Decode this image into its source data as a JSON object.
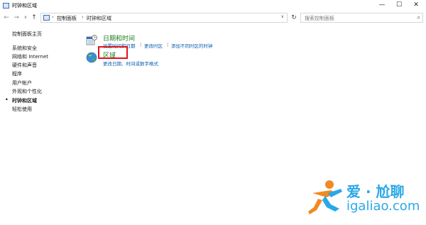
{
  "window": {
    "title": "时钟和区域",
    "minimize_glyph": "—",
    "maximize_glyph": "☐",
    "close_glyph": "✕"
  },
  "nav": {
    "back_glyph": "←",
    "forward_glyph": "→",
    "dropdown_glyph": "∨",
    "up_glyph": "↑",
    "refresh_glyph": "↻"
  },
  "address": {
    "separator": "›",
    "crumbs": [
      "控制面板",
      "时钟和区域"
    ],
    "dropdown_glyph": "∨"
  },
  "search": {
    "placeholder": "搜索控制面板",
    "icon_glyph": "⌕"
  },
  "sidebar": {
    "home": "控制面板主页",
    "items": [
      {
        "label": "系统和安全"
      },
      {
        "label": "网络和 Internet"
      },
      {
        "label": "硬件和声音"
      },
      {
        "label": "程序"
      },
      {
        "label": "用户帐户"
      },
      {
        "label": "外观和个性化"
      },
      {
        "label": "时钟和区域"
      },
      {
        "label": "轻松使用"
      }
    ],
    "active_index": 6,
    "bullet": "•"
  },
  "categories": [
    {
      "title": "日期和时间",
      "links": [
        "设置时间和日期",
        "更改时区",
        "添加不同时区的时钟"
      ],
      "link_separator": "|"
    },
    {
      "title": "区域",
      "links": [
        "更改日期、时间或数字格式"
      ]
    }
  ],
  "watermark": {
    "text": "爱 · 尬聊",
    "url": "igaliao.com"
  },
  "colors": {
    "link": "#0b5fb0",
    "category_title": "#1e7a1e",
    "highlight_border": "#e0141a",
    "watermark": "#2aa8e6"
  }
}
